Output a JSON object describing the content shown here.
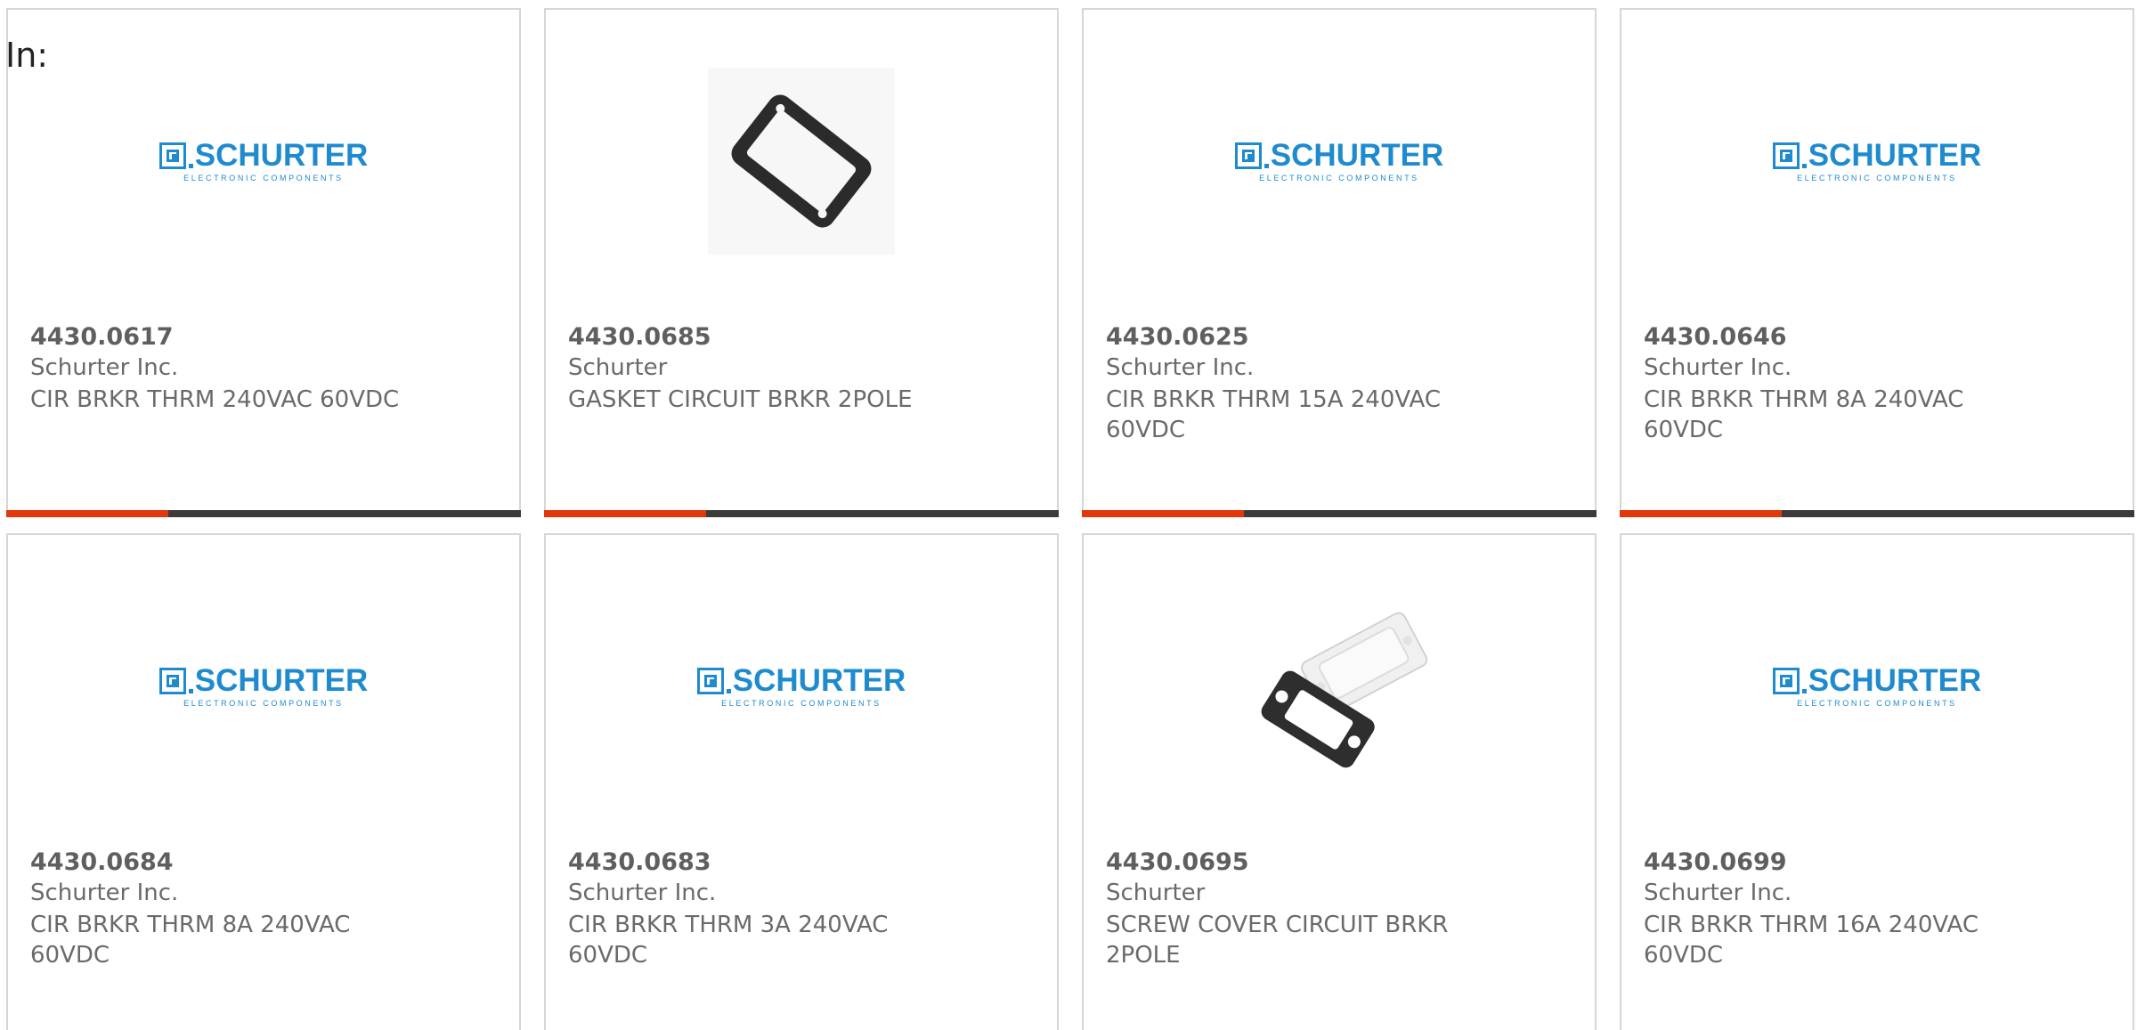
{
  "filter": {
    "in_label": "In:"
  },
  "logo": {
    "word": "SCHURTER",
    "tagline": "ELECTRONIC COMPONENTS",
    "color": "#1f8bcf"
  },
  "colors": {
    "accent": "#e0380a",
    "bar": "#3b3b3b",
    "card_border": "#d6d6d6",
    "text": "#6a6a6a"
  },
  "products": [
    {
      "part_number": "4430.0617",
      "manufacturer": "Schurter Inc.",
      "description": "CIR BRKR THRM 240VAC 60VDC",
      "image": "schurter-logo"
    },
    {
      "part_number": "4430.0685",
      "manufacturer": "Schurter",
      "description": "GASKET CIRCUIT BRKR 2POLE",
      "image": "gasket-photo"
    },
    {
      "part_number": "4430.0625",
      "manufacturer": "Schurter Inc.",
      "description": "CIR BRKR THRM 15A 240VAC 60VDC",
      "image": "schurter-logo"
    },
    {
      "part_number": "4430.0646",
      "manufacturer": "Schurter Inc.",
      "description": "CIR BRKR THRM 8A 240VAC 60VDC",
      "image": "schurter-logo"
    },
    {
      "part_number": "4430.0684",
      "manufacturer": "Schurter Inc.",
      "description": "CIR BRKR THRM 8A 240VAC 60VDC",
      "image": "schurter-logo"
    },
    {
      "part_number": "4430.0683",
      "manufacturer": "Schurter Inc.",
      "description": "CIR BRKR THRM 3A 240VAC 60VDC",
      "image": "schurter-logo"
    },
    {
      "part_number": "4430.0695",
      "manufacturer": "Schurter",
      "description": "SCREW COVER CIRCUIT BRKR 2POLE",
      "image": "screw-cover-photo"
    },
    {
      "part_number": "4430.0699",
      "manufacturer": "Schurter Inc.",
      "description": "CIR BRKR THRM 16A 240VAC 60VDC",
      "image": "schurter-logo"
    }
  ]
}
